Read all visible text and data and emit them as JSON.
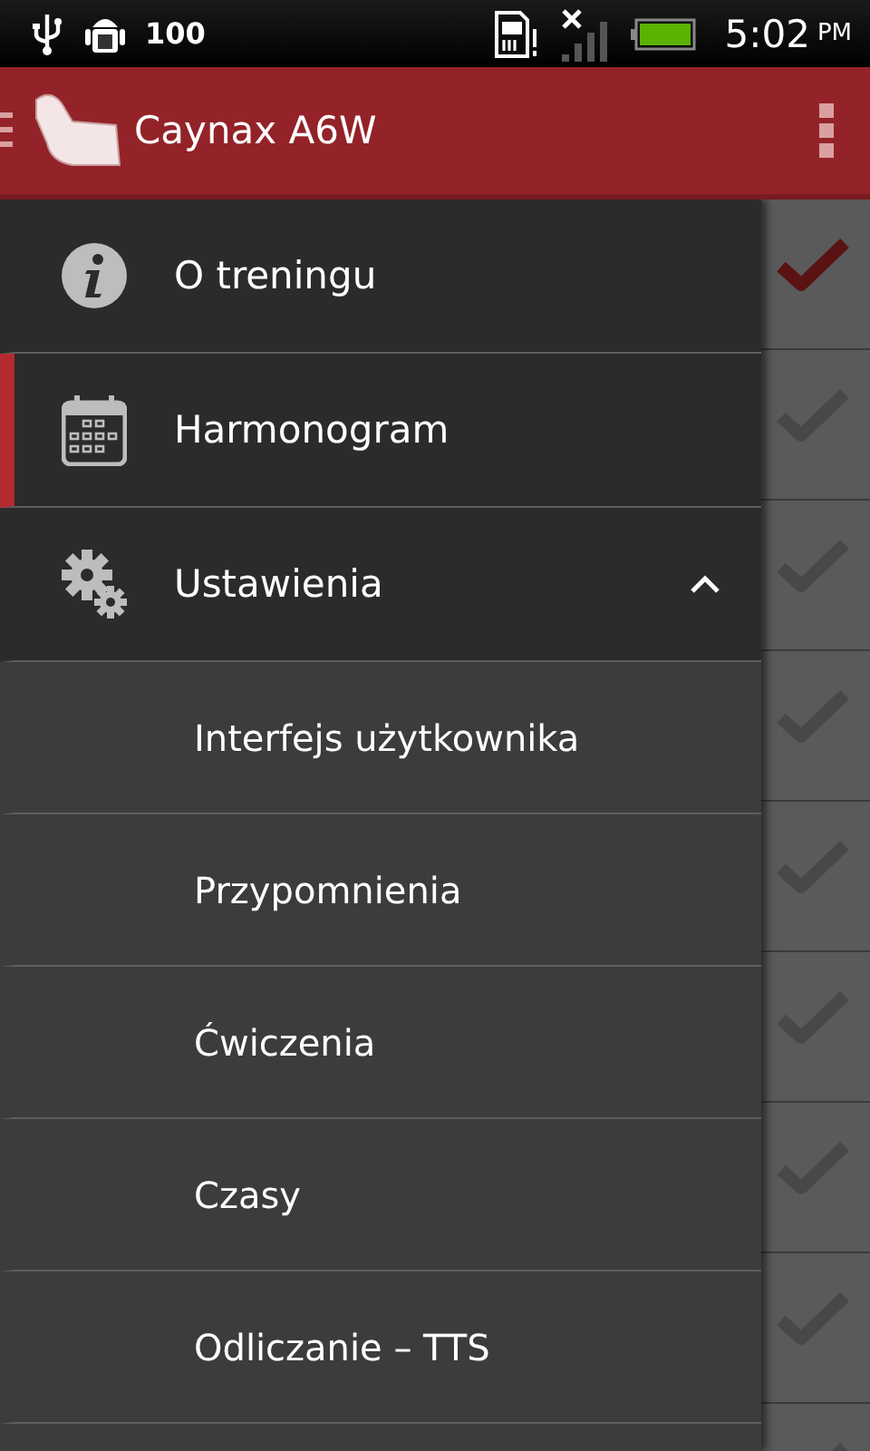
{
  "status_bar": {
    "battery_text": "100",
    "time": "5:02",
    "ampm": "PM"
  },
  "app_bar": {
    "title": "Caynax A6W"
  },
  "drawer": {
    "items": [
      {
        "kind": "info",
        "label": "O treningu",
        "selected": false
      },
      {
        "kind": "calendar",
        "label": "Harmonogram",
        "selected": true
      },
      {
        "kind": "settings",
        "label": "Ustawienia",
        "selected": false,
        "expanded": true,
        "children": [
          {
            "label": "Interfejs użytkownika",
            "selected": false
          },
          {
            "label": "Przypomnienia",
            "selected": false
          },
          {
            "label": "Ćwiczenia",
            "selected": false
          },
          {
            "label": "Czasy",
            "selected": false
          },
          {
            "label": "Odliczanie – TTS",
            "selected": false
          }
        ]
      }
    ]
  },
  "day_checks": [
    {
      "checked": true
    },
    {
      "checked": false
    },
    {
      "checked": false
    },
    {
      "checked": false
    },
    {
      "checked": false
    },
    {
      "checked": false
    },
    {
      "checked": false
    },
    {
      "checked": false
    },
    {
      "checked": false
    }
  ]
}
